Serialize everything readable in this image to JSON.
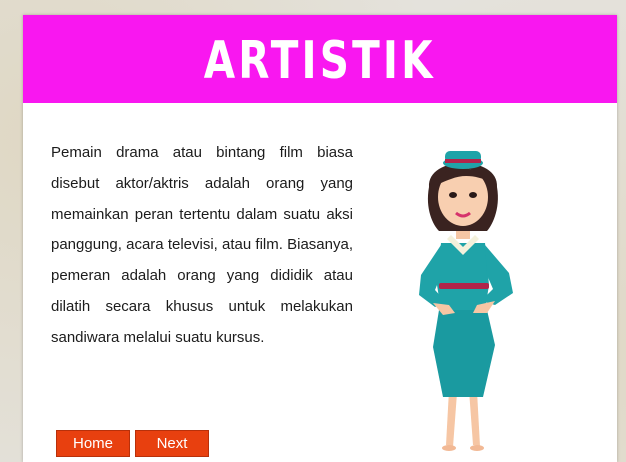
{
  "header": {
    "title": "ARTISTIK",
    "background_color": "#f917f0"
  },
  "content": {
    "paragraph": "Pemain drama atau bintang film biasa disebut aktor/aktris adalah orang yang memainkan peran tertentu dalam suatu aksi panggung, acara televisi, atau film. Biasanya, pemeran adalah orang yang dididik atau dilatih secara khusus untuk melakukan sandiwara melalui suatu kursus."
  },
  "illustration": {
    "icon": "actress-figure-icon",
    "dress_color": "#1fa3a8"
  },
  "navigation": {
    "home_label": "Home",
    "next_label": "Next",
    "button_color": "#e8400f"
  }
}
